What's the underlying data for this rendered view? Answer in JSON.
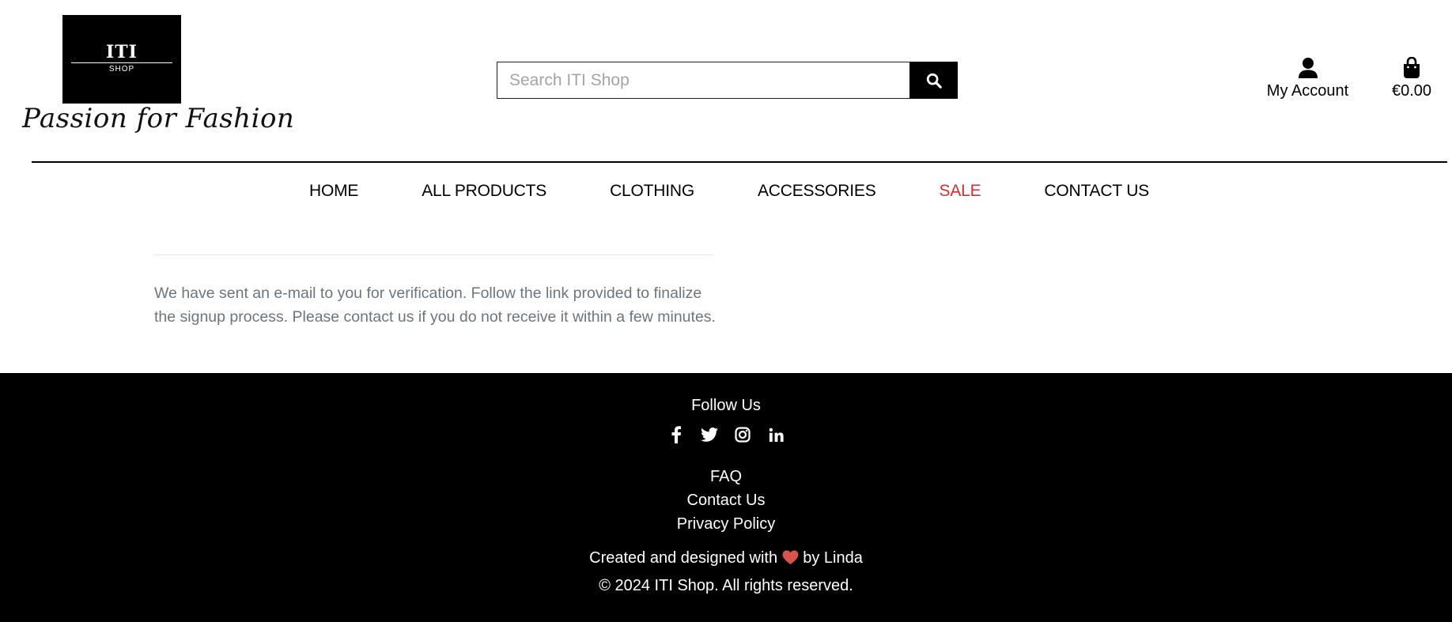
{
  "brand": {
    "logo_title": "ITI",
    "logo_subtitle": "SHOP",
    "tagline": "Passion for Fashion"
  },
  "search": {
    "placeholder": "Search ITI Shop",
    "value": "",
    "button_icon": "search-icon"
  },
  "account": {
    "label": "My Account",
    "icon": "user-icon"
  },
  "cart": {
    "total": "€0.00",
    "icon": "shopping-bag-icon"
  },
  "nav": {
    "items": [
      {
        "label": "HOME"
      },
      {
        "label": "ALL PRODUCTS"
      },
      {
        "label": "CLOTHING"
      },
      {
        "label": "ACCESSORIES"
      },
      {
        "label": "SALE",
        "color": "#d32f2f"
      },
      {
        "label": "CONTACT US"
      }
    ]
  },
  "main": {
    "message": "We have sent an e-mail to you for verification. Follow the link provided to finalize the signup process. Please contact us if you do not receive it within a few minutes."
  },
  "footer": {
    "follow_title": "Follow Us",
    "socials": [
      "facebook-icon",
      "twitter-icon",
      "instagram-icon",
      "linkedin-icon"
    ],
    "links": [
      {
        "label": "FAQ"
      },
      {
        "label": "Contact Us"
      },
      {
        "label": "Privacy Policy"
      }
    ],
    "credit_before": "Created and designed with",
    "credit_after": "by Linda",
    "heart_color": "#d9534f",
    "copyright": "© 2024 ITI Shop. All rights reserved."
  }
}
